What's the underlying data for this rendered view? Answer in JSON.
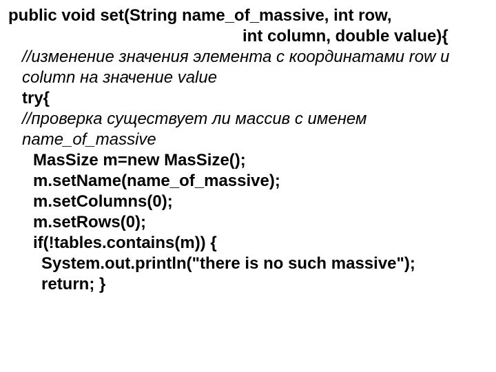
{
  "code": {
    "sigLine1": "public void set(String name_of_massive, int row,",
    "sigLine2": "int column, double value){",
    "comment1a": "//изменение значения элемента с координатами row и",
    "comment1b": "column на значение value",
    "tryOpen": "try{",
    "comment2a": "//проверка существует ли массив с именем",
    "comment2b": "name_of_massive",
    "l1": "MasSize m=new MasSize();",
    "l2": "m.setName(name_of_massive);",
    "l3": "m.setColumns(0);",
    "l4": "m.setRows(0);",
    "l5": "if(!tables.contains(m)) {",
    "l6": "System.out.println(\"there is no such massive\");",
    "l7": "return; }"
  }
}
